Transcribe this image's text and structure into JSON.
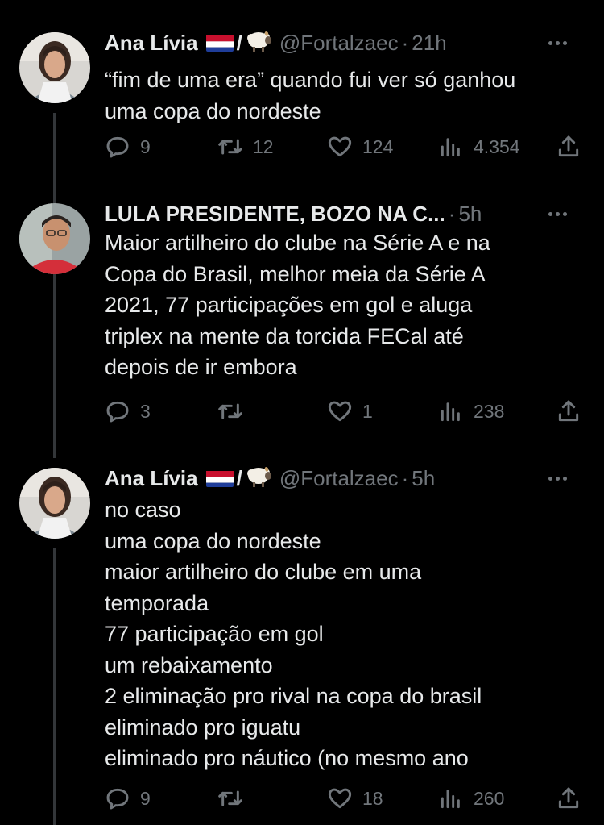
{
  "tweets": [
    {
      "name": "Ana Lívia",
      "emoji_slash": "/",
      "handle": "@Fortalzaec",
      "sep": "·",
      "time": "21h",
      "lines": [
        "“fim de uma era” quando fui ver só ganhou",
        "uma copa do nordeste"
      ],
      "replies": "9",
      "retweets": "12",
      "likes": "124",
      "views": "4.354"
    },
    {
      "name": "LULA PRESIDENTE, BOZO NA C...",
      "sep": "·",
      "time": "5h",
      "lines": [
        "Maior artilheiro do clube na Série A e na",
        "Copa do Brasil, melhor meia da Série A",
        "2021, 77 participações em gol e aluga",
        "triplex na mente da torcida FECal até",
        "depois de ir embora"
      ],
      "replies": "3",
      "retweets": "",
      "likes": "1",
      "views": "238"
    },
    {
      "name": "Ana Lívia",
      "emoji_slash": "/",
      "handle": "@Fortalzaec",
      "sep": "·",
      "time": "5h",
      "lines": [
        "no caso",
        "uma copa do nordeste",
        "maior artilheiro do clube em uma",
        "temporada",
        "77 participação em gol",
        "um rebaixamento",
        "2 eliminação pro rival na copa do brasil",
        "eliminado pro iguatu",
        "eliminado pro náutico (no mesmo ano"
      ],
      "replies": "9",
      "retweets": "",
      "likes": "18",
      "views": "260"
    }
  ],
  "icons": {
    "reply": "reply-icon",
    "retweet": "retweet-icon",
    "like": "heart-icon",
    "views": "views-icon",
    "share": "share-icon",
    "more": "more-icon",
    "flag": "netherlands-flag-icon",
    "sheep": "sheep-emoji-icon"
  },
  "colors": {
    "background": "#000000",
    "text": "#e7e9ea",
    "muted": "#71767b",
    "thread_line": "#333639"
  }
}
